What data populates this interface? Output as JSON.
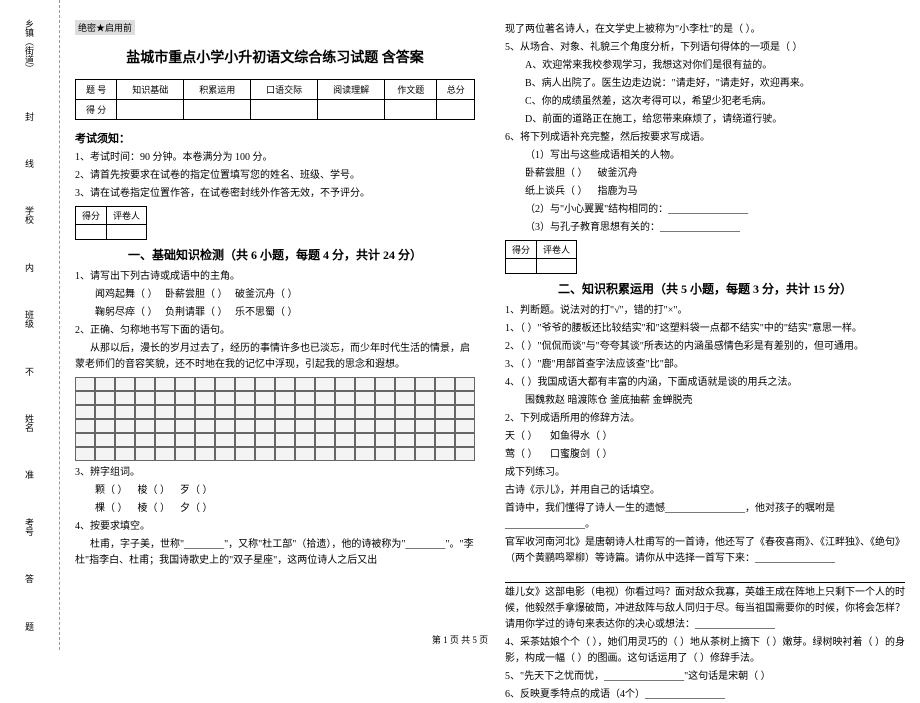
{
  "margin": {
    "items": [
      "乡镇（街道）",
      "封",
      "线",
      "学校",
      "内",
      "班级",
      "不",
      "姓名",
      "准",
      "考号",
      "答",
      "题"
    ]
  },
  "confidential": "绝密★启用前",
  "title": "盐城市重点小学小升初语文综合练习试题 含答案",
  "score_headers": [
    "题 号",
    "知识基础",
    "积累运用",
    "口语交际",
    "阅读理解",
    "作文题",
    "总分"
  ],
  "score_row": "得 分",
  "notice_title": "考试须知：",
  "notices": [
    "1、考试时间：90 分钟。本卷满分为 100 分。",
    "2、请首先按要求在试卷的指定位置填写您的姓名、班级、学号。",
    "3、请在试卷指定位置作答，在试卷密封线外作答无效，不予评分。"
  ],
  "mini_headers": [
    "得分",
    "评卷人"
  ],
  "section1_title": "一、基础知识检测（共 6 小题，每题 4 分，共计 24 分）",
  "q1_1": "1、请写出下列古诗或成语中的主角。",
  "q1_1_items": [
    "闻鸡起舞（    ）",
    "卧薪尝胆（    ）",
    "破釜沉舟（    ）",
    "鞠躬尽瘁（    ）",
    "负荆请罪（    ）",
    "乐不思蜀（    ）"
  ],
  "q1_2": "2、正确、匀称地书写下面的语句。",
  "q1_2_text": "从那以后，漫长的岁月过去了，经历的事情许多也已淡忘，而少年时代生活的情景，启蒙老师们的音容笑貌，还不时地在我的记忆中浮现，引起我的思念和遐想。",
  "q1_3": "3、辨字组词。",
  "q1_3_items": [
    "颗（    ）",
    "梭（    ）",
    "歹（    ）",
    "棵（    ）",
    "棱（    ）",
    "夕（    ）"
  ],
  "q1_4": "4、按要求填空。",
  "q1_4_text": "杜甫，字子美，世称\"________\"，又称\"杜工部\"（拾遗），他的诗被称为\"________\"。\"李杜\"指李白、杜甫；我国诗歌史上的\"双子星座\"，这两位诗人之后又出",
  "r_top": "现了两位著名诗人，在文学史上被称为\"小李杜\"的是（        ）。",
  "q1_5": "5、从场合、对象、礼貌三个角度分析，下列语句得体的一项是（   ）",
  "q1_5_opts": [
    "A、欢迎常来我校参观学习，我想这对你们是很有益的。",
    "B、病人出院了。医生边走边说：\"请走好，\"请走好，欢迎再来。",
    "C、你的成绩虽然差，这次考得可以，希望少犯老毛病。",
    "D、前面的道路正在施工，给您带来麻烦了，请绕道行驶。"
  ],
  "q1_6": "6、将下列成语补充完整，然后按要求写成语。",
  "q1_6_sub1": "（1）写出与这些成语相关的人物。",
  "q1_6_items": [
    "卧薪尝胆（    ）",
    "破釜沉舟",
    "纸上谈兵（    ）",
    "指鹿为马"
  ],
  "q1_6_sub2": "（2）与\"小心翼翼\"结构相同的：________________",
  "q1_6_sub3": "（3）与孔子教育思想有关的：________________",
  "section2_title": "二、知识积累运用（共 5 小题，每题 3 分，共计 15 分）",
  "q2_1": "1、判断题。说法对的打\"√\"，错的打\"×\"。",
  "q2_1_items": [
    "1、（  ）\"爷爷的腰板还比较结实\"和\"这塑料袋一点都不结实\"中的\"结实\"意思一样。",
    "2、（  ）\"侃侃而谈\"与\"夸夸其谈\"所表达的内涵虽感情色彩是有差别的，但可通用。",
    "3、（  ）\"鹿\"用部首查字法应该查\"比\"部。",
    "4、（  ）我国成语大都有丰富的内涵，下面成语就是谈的用兵之法。"
  ],
  "q2_1_line": "围魏救赵     暗渡陈仓     釜底抽薪     金蝉脱壳",
  "q2_2": "2、下列成语所用的修辞方法。",
  "q2_2_items": [
    "天（     ）",
    "如鱼得水（     ）",
    "莺（     ）",
    "口蜜腹剑（     ）"
  ],
  "q2_3": "成下列练习。",
  "q2_3_text1": "古诗《示儿》，并用自己的话填空。",
  "q2_3_text2": "首诗中，我们懂得了诗人一生的遗憾________________，他对孩子的嘱咐是________________。",
  "q2_3_text3": "官军收河南河北》是唐朝诗人杜甫写的一首诗，他还写了《春夜喜雨》、《江畔独》、《绝句》（两个黄鹂鸣翠柳）等诗篇。请你从中选择一首写下来：________________",
  "q2_3_text4": "雄儿女》这部电影（电视）你看过吗？面对敌众我寡，英雄王成在阵地上只剩下一个人的时候，他毅然手拿爆破筒，冲进敌阵与敌人同归于尽。每当祖国需要你的时候，你将会怎样？请用你学过的诗句来表达你的决心或想法：________________",
  "q2_4": "4、采茶姑娘个个（     ），她们用灵巧的（     ）地从茶树上摘下（     ）嫩芽。绿树映衬着（     ）的身影，构成一幅（     ）的图画。这句话运用了（     ）修辞手法。",
  "q2_5": "5、\"先天下之忧而忧，________________\"这句话是宋朝（     ）",
  "q2_6": "6、反映夏季特点的成语（4个）________________",
  "footer": "第 1 页 共 5 页"
}
